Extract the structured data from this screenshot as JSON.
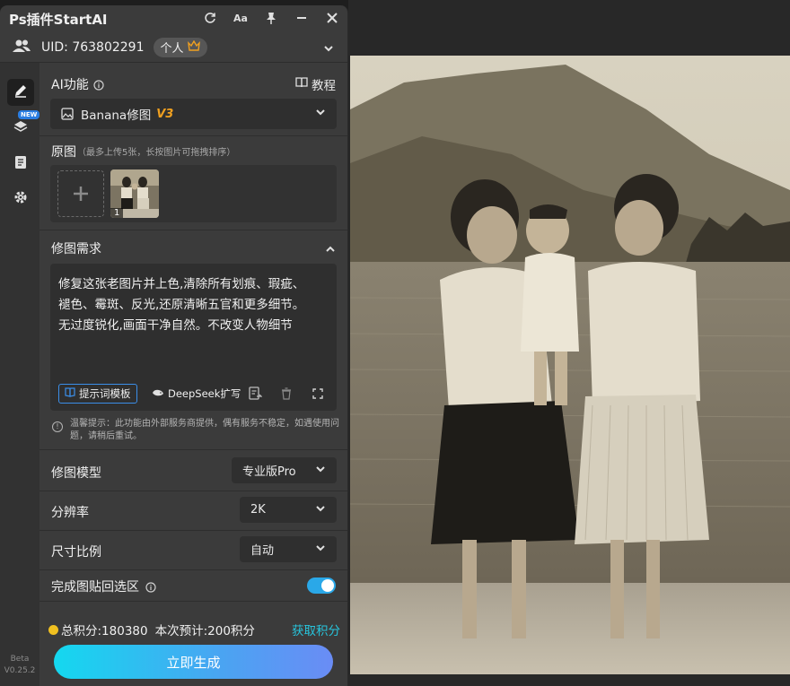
{
  "app": {
    "title": "Ps插件StartAI",
    "uid_label": "UID: 763802291",
    "account_badge": "个人"
  },
  "rail": {
    "new_badge": "NEW",
    "version_line1": "Beta",
    "version_line2": "V0.25.2"
  },
  "ai_function": {
    "label": "AI功能",
    "tutorial": "教程",
    "selected": "Banana修图",
    "version_tag": "V3"
  },
  "source": {
    "label": "原图",
    "hint": "（最多上传5张，长按图片可拖拽排序）",
    "thumb_index": "1"
  },
  "prompt": {
    "label": "修图需求",
    "line1": "修复这张老图片并上色,清除所有划痕、瑕疵、",
    "line2": "褪色、霉斑、反光,还原清晰五官和更多细节。",
    "line3": "无过度锐化,画面干净自然。不改变人物细节",
    "template_button": "提示词模板",
    "deepseek_button": "DeepSeek扩写"
  },
  "notice": {
    "text": "温馨提示：此功能由外部服务商提供，偶有服务不稳定，如遇使用问题，请稍后重试。"
  },
  "settings": {
    "model_label": "修图模型",
    "model_value": "专业版Pro",
    "resolution_label": "分辨率",
    "resolution_value": "2K",
    "ratio_label": "尺寸比例",
    "ratio_value": "自动",
    "paste_label": "完成图贴回选区",
    "paste_enabled": true
  },
  "footer": {
    "total_points": "总积分:180380",
    "estimate": "本次预计:200积分",
    "get_points": "获取积分",
    "generate": "立即生成"
  },
  "colors": {
    "accent": "#27c5dd",
    "toggle": "#2aa8e8",
    "version_tag": "#f0a020"
  }
}
